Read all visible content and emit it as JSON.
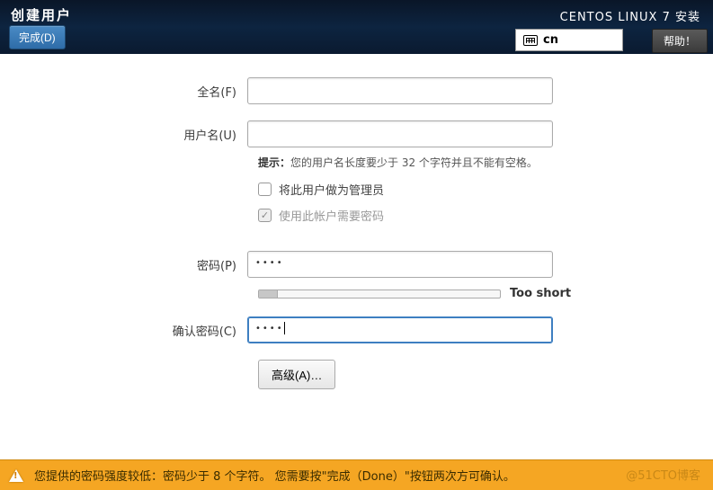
{
  "header": {
    "title": "创建用户",
    "done_label": "完成(D)",
    "subtitle": "CENTOS LINUX 7 安装",
    "keyboard": "cn",
    "help_label": "帮助！"
  },
  "form": {
    "full_name": {
      "label": "全名(F)",
      "value": ""
    },
    "username": {
      "label": "用户名(U)",
      "value": ""
    },
    "hint_prefix": "提示：",
    "hint_text": "您的用户名长度要少于 32 个字符并且不能有空格。",
    "admin_checkbox": {
      "label": "将此用户做为管理员",
      "checked": false
    },
    "require_pw_checkbox": {
      "label": "使用此帐户需要密码",
      "checked": true
    },
    "password": {
      "label": "密码(P)",
      "value": "••••"
    },
    "strength": {
      "label": "Too short",
      "percent": 8
    },
    "confirm": {
      "label": "确认密码(C)",
      "value": "••••"
    },
    "advanced_label": "高级(A)…"
  },
  "warning": {
    "text": "您提供的密码强度较低：密码少于 8 个字符。 您需要按\"完成（Done）\"按钮两次方可确认。"
  },
  "watermark": "@51CTO博客"
}
